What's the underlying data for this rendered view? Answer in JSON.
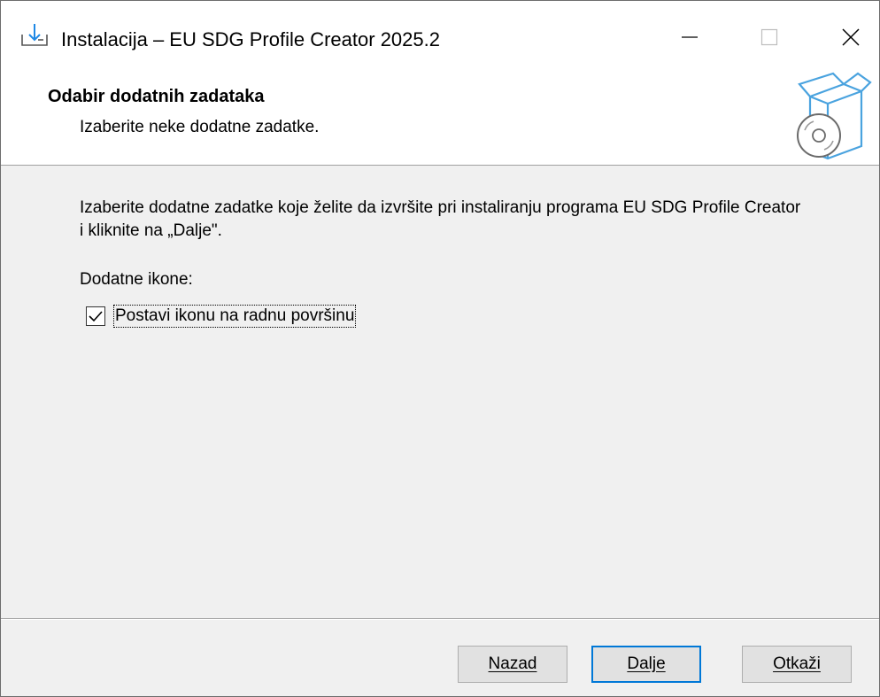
{
  "window": {
    "title": "Instalacija – EU SDG Profile Creator 2025.2",
    "icons": {
      "app": "download-install-icon",
      "minimize": "minimize-icon",
      "maximize": "maximize-icon",
      "close": "close-icon"
    }
  },
  "header": {
    "title": "Odabir dodatnih zadataka",
    "subtitle": "Izaberite neke dodatne zadatke.",
    "image_icon": "box-cd-icon"
  },
  "content": {
    "description": "Izaberite dodatne zadatke koje želite da izvršite pri instaliranju programa EU SDG Profile Creator i kliknite na „Dalje\".",
    "group_label": "Dodatne ikone:",
    "tasks": [
      {
        "label": "Postavi ikonu na radnu površinu",
        "checked": true
      }
    ]
  },
  "buttons": {
    "back": "Nazad",
    "next": "Dalje",
    "cancel": "Otkaži"
  },
  "colors": {
    "accent": "#0078d7",
    "icon_blue": "#4aa3df"
  }
}
